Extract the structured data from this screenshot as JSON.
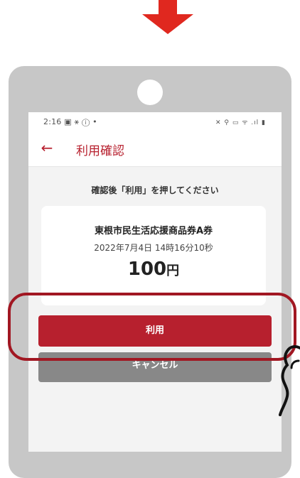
{
  "status_bar": {
    "time": "2:16 ▣ ⚹ ⓘ •",
    "icons": "✕ ⚲ ▭ ᯤ .ıl ▮"
  },
  "appbar": {
    "title": "利用確認"
  },
  "instruction": "確認後「利用」を押してください",
  "ticket": {
    "name": "東根市民生活応援商品券A券",
    "datetime": "2022年7月4日 14時16分10秒",
    "amount": "100",
    "unit": "円"
  },
  "buttons": {
    "use": "利用",
    "cancel": "キャンセル"
  },
  "colors": {
    "accent": "#b7202e",
    "highlight": "#a11722",
    "arrow": "#e0281f",
    "cancel": "#888888"
  },
  "icons": [
    "down-arrow-icon",
    "back-arrow-icon",
    "pointing-hand-icon"
  ]
}
